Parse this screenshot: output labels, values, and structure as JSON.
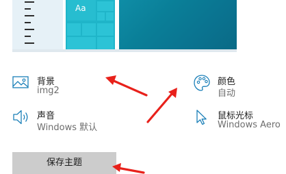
{
  "preview": {
    "tile_label": "Aa"
  },
  "items": {
    "background": {
      "title": "背景",
      "value": "img2",
      "icon": "image-icon"
    },
    "color": {
      "title": "颜色",
      "value": "自动",
      "icon": "palette-icon"
    },
    "sound": {
      "title": "声音",
      "value": "Windows 默认",
      "icon": "speaker-icon"
    },
    "cursor": {
      "title": "鼠标光标",
      "value": "Windows Aero",
      "icon": "cursor-icon"
    }
  },
  "save_button": {
    "label": "保存主题"
  },
  "colors": {
    "accent": "#1a7fb8",
    "annotation": "#e8211b",
    "button": "#cccccc"
  }
}
